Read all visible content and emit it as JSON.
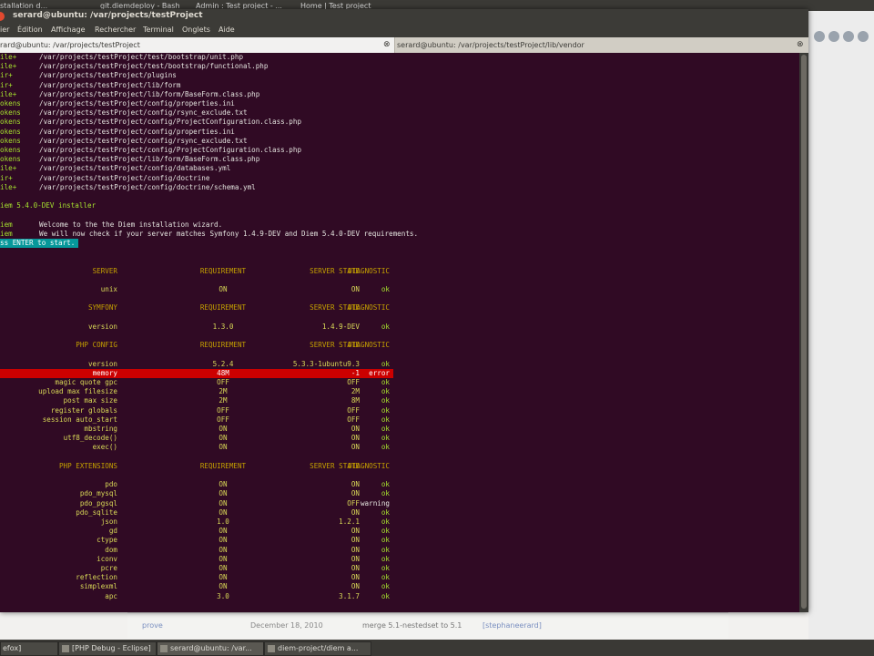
{
  "window": {
    "title": "serard@ubuntu: /var/projects/testProject"
  },
  "menubar": [
    "ier",
    "Édition",
    "Affichage",
    "Rechercher",
    "Terminal",
    "Onglets",
    "Aide"
  ],
  "tabs": [
    {
      "label": "rard@ubuntu: /var/projects/testProject"
    },
    {
      "label": "serard@ubuntu: /var/projects/testProject/lib/vendor"
    }
  ],
  "tab_close": "⊗",
  "log_lines": [
    {
      "prefix": "ile+",
      "text": "/var/projects/testProject/test/bootstrap/unit.php"
    },
    {
      "prefix": "ile+",
      "text": "/var/projects/testProject/test/bootstrap/functional.php"
    },
    {
      "prefix": "ir+",
      "text": "/var/projects/testProject/plugins"
    },
    {
      "prefix": "ir+",
      "text": "/var/projects/testProject/lib/form"
    },
    {
      "prefix": "ile+",
      "text": "/var/projects/testProject/lib/form/BaseForm.class.php"
    },
    {
      "prefix": "okens",
      "text": "/var/projects/testProject/config/properties.ini"
    },
    {
      "prefix": "okens",
      "text": "/var/projects/testProject/config/rsync_exclude.txt"
    },
    {
      "prefix": "okens",
      "text": "/var/projects/testProject/config/ProjectConfiguration.class.php"
    },
    {
      "prefix": "okens",
      "text": "/var/projects/testProject/config/properties.ini"
    },
    {
      "prefix": "okens",
      "text": "/var/projects/testProject/config/rsync_exclude.txt"
    },
    {
      "prefix": "okens",
      "text": "/var/projects/testProject/config/ProjectConfiguration.class.php"
    },
    {
      "prefix": "okens",
      "text": "/var/projects/testProject/lib/form/BaseForm.class.php"
    },
    {
      "prefix": "ile+",
      "text": "/var/projects/testProject/config/databases.yml"
    },
    {
      "prefix": "ir+",
      "text": "/var/projects/testProject/config/doctrine"
    },
    {
      "prefix": "ile+",
      "text": "/var/projects/testProject/config/doctrine/schema.yml"
    }
  ],
  "installer_title": "iem 5.4.0-DEV installer",
  "intro_lines": [
    {
      "prefix": "iem",
      "text": "Welcome to the the Diem installation wizard."
    },
    {
      "prefix": "iem",
      "text": "We will now check if your server matches Symfony 1.4.9-DEV and Diem 5.4.0-DEV requirements."
    }
  ],
  "prompt": "ss ENTER to start.",
  "sections": [
    {
      "headers": [
        "SERVER",
        "REQUIREMENT",
        "SERVER STATE",
        "DIAGNOSTIC"
      ],
      "rows": [
        {
          "name": "unix",
          "req": "ON",
          "state": "ON",
          "diag": "ok"
        }
      ]
    },
    {
      "headers": [
        "SYMFONY",
        "REQUIREMENT",
        "SERVER STATE",
        "DIAGNOSTIC"
      ],
      "rows": [
        {
          "name": "version",
          "req": "1.3.0",
          "state": "1.4.9-DEV",
          "diag": "ok"
        }
      ]
    },
    {
      "headers": [
        "PHP CONFIG",
        "REQUIREMENT",
        "SERVER STATE",
        "DIAGNOSTIC"
      ],
      "rows": [
        {
          "name": "version",
          "req": "5.2.4",
          "state": "5.3.3-1ubuntu9.3",
          "diag": "ok"
        },
        {
          "name": "memory",
          "req": "48M",
          "state": "-1",
          "diag": "error"
        },
        {
          "name": "magic quote gpc",
          "req": "OFF",
          "state": "OFF",
          "diag": "ok"
        },
        {
          "name": "upload max filesize",
          "req": "2M",
          "state": "2M",
          "diag": "ok"
        },
        {
          "name": "post max size",
          "req": "2M",
          "state": "8M",
          "diag": "ok"
        },
        {
          "name": "register globals",
          "req": "OFF",
          "state": "OFF",
          "diag": "ok"
        },
        {
          "name": "session auto_start",
          "req": "OFF",
          "state": "OFF",
          "diag": "ok"
        },
        {
          "name": "mbstring",
          "req": "ON",
          "state": "ON",
          "diag": "ok"
        },
        {
          "name": "utf8_decode()",
          "req": "ON",
          "state": "ON",
          "diag": "ok"
        },
        {
          "name": "exec()",
          "req": "ON",
          "state": "ON",
          "diag": "ok"
        }
      ]
    },
    {
      "headers": [
        "PHP EXTENSIONS",
        "REQUIREMENT",
        "SERVER STATE",
        "DIAGNOSTIC"
      ],
      "rows": [
        {
          "name": "pdo",
          "req": "ON",
          "state": "ON",
          "diag": "ok"
        },
        {
          "name": "pdo_mysql",
          "req": "ON",
          "state": "ON",
          "diag": "ok"
        },
        {
          "name": "pdo_pgsql",
          "req": "ON",
          "state": "OFF",
          "diag": "warning"
        },
        {
          "name": "pdo_sqlite",
          "req": "ON",
          "state": "ON",
          "diag": "ok"
        },
        {
          "name": "json",
          "req": "1.0",
          "state": "1.2.1",
          "diag": "ok"
        },
        {
          "name": "gd",
          "req": "ON",
          "state": "ON",
          "diag": "ok"
        },
        {
          "name": "ctype",
          "req": "ON",
          "state": "ON",
          "diag": "ok"
        },
        {
          "name": "dom",
          "req": "ON",
          "state": "ON",
          "diag": "ok"
        },
        {
          "name": "iconv",
          "req": "ON",
          "state": "ON",
          "diag": "ok"
        },
        {
          "name": "pcre",
          "req": "ON",
          "state": "ON",
          "diag": "ok"
        },
        {
          "name": "reflection",
          "req": "ON",
          "state": "ON",
          "diag": "ok"
        },
        {
          "name": "simplexml",
          "req": "ON",
          "state": "ON",
          "diag": "ok"
        },
        {
          "name": "apc",
          "req": "3.0",
          "state": "3.1.7",
          "diag": "ok"
        }
      ]
    }
  ],
  "background": {
    "tabs": [
      "stallation d...",
      "git.diemdeploy - Bash",
      "Admin : Test project - ...",
      "Home | Test project"
    ],
    "bottom": [
      "prove",
      "December 18, 2010",
      "merge 5.1-nestedset to 5.1",
      "[stephaneerard]"
    ]
  },
  "taskbar": [
    {
      "label": "efox]"
    },
    {
      "label": "[PHP Debug - Eclipse]"
    },
    {
      "label": "serard@ubuntu: /var..."
    },
    {
      "label": "diem-project/diem a..."
    }
  ],
  "colors": {
    "terminal_bg": "#300a24",
    "error_bg": "#cc0000",
    "ok": "#a6e22e",
    "header": "#c4a000"
  }
}
